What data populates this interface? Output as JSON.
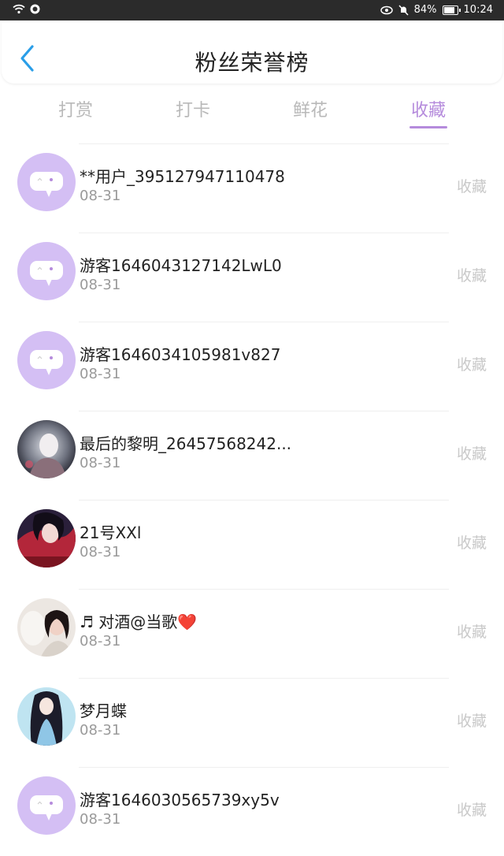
{
  "status_bar": {
    "battery": "84%",
    "time": "10:24"
  },
  "header": {
    "title": "粉丝荣誉榜"
  },
  "tabs": [
    {
      "label": "打赏"
    },
    {
      "label": "打卡"
    },
    {
      "label": "鲜花"
    },
    {
      "label": "收藏",
      "active": true
    }
  ],
  "colors": {
    "accent": "#b58bdc",
    "back_icon": "#2a9ee8",
    "default_avatar": "#d4bff4"
  },
  "list": [
    {
      "name": "**用户_395127947110478",
      "date": "08-31",
      "action": "收藏",
      "avatar": "default-avatar"
    },
    {
      "name": "游客1646043127142LwL0",
      "date": "08-31",
      "action": "收藏",
      "avatar": "default-avatar"
    },
    {
      "name": "游客1646034105981v827",
      "date": "08-31",
      "action": "收藏",
      "avatar": "default-avatar"
    },
    {
      "name": "最后的黎明_26457568242...",
      "date": "08-31",
      "action": "收藏",
      "avatar": "photo-avatar"
    },
    {
      "name": "21号XXl",
      "date": "08-31",
      "action": "收藏",
      "avatar": "photo-avatar"
    },
    {
      "name": "♬ 对酒@当歌❤️",
      "date": "08-31",
      "action": "收藏",
      "avatar": "photo-avatar"
    },
    {
      "name": "梦月蝶",
      "date": "08-31",
      "action": "收藏",
      "avatar": "photo-avatar"
    },
    {
      "name": "游客1646030565739xy5v",
      "date": "08-31",
      "action": "收藏",
      "avatar": "default-avatar"
    }
  ]
}
